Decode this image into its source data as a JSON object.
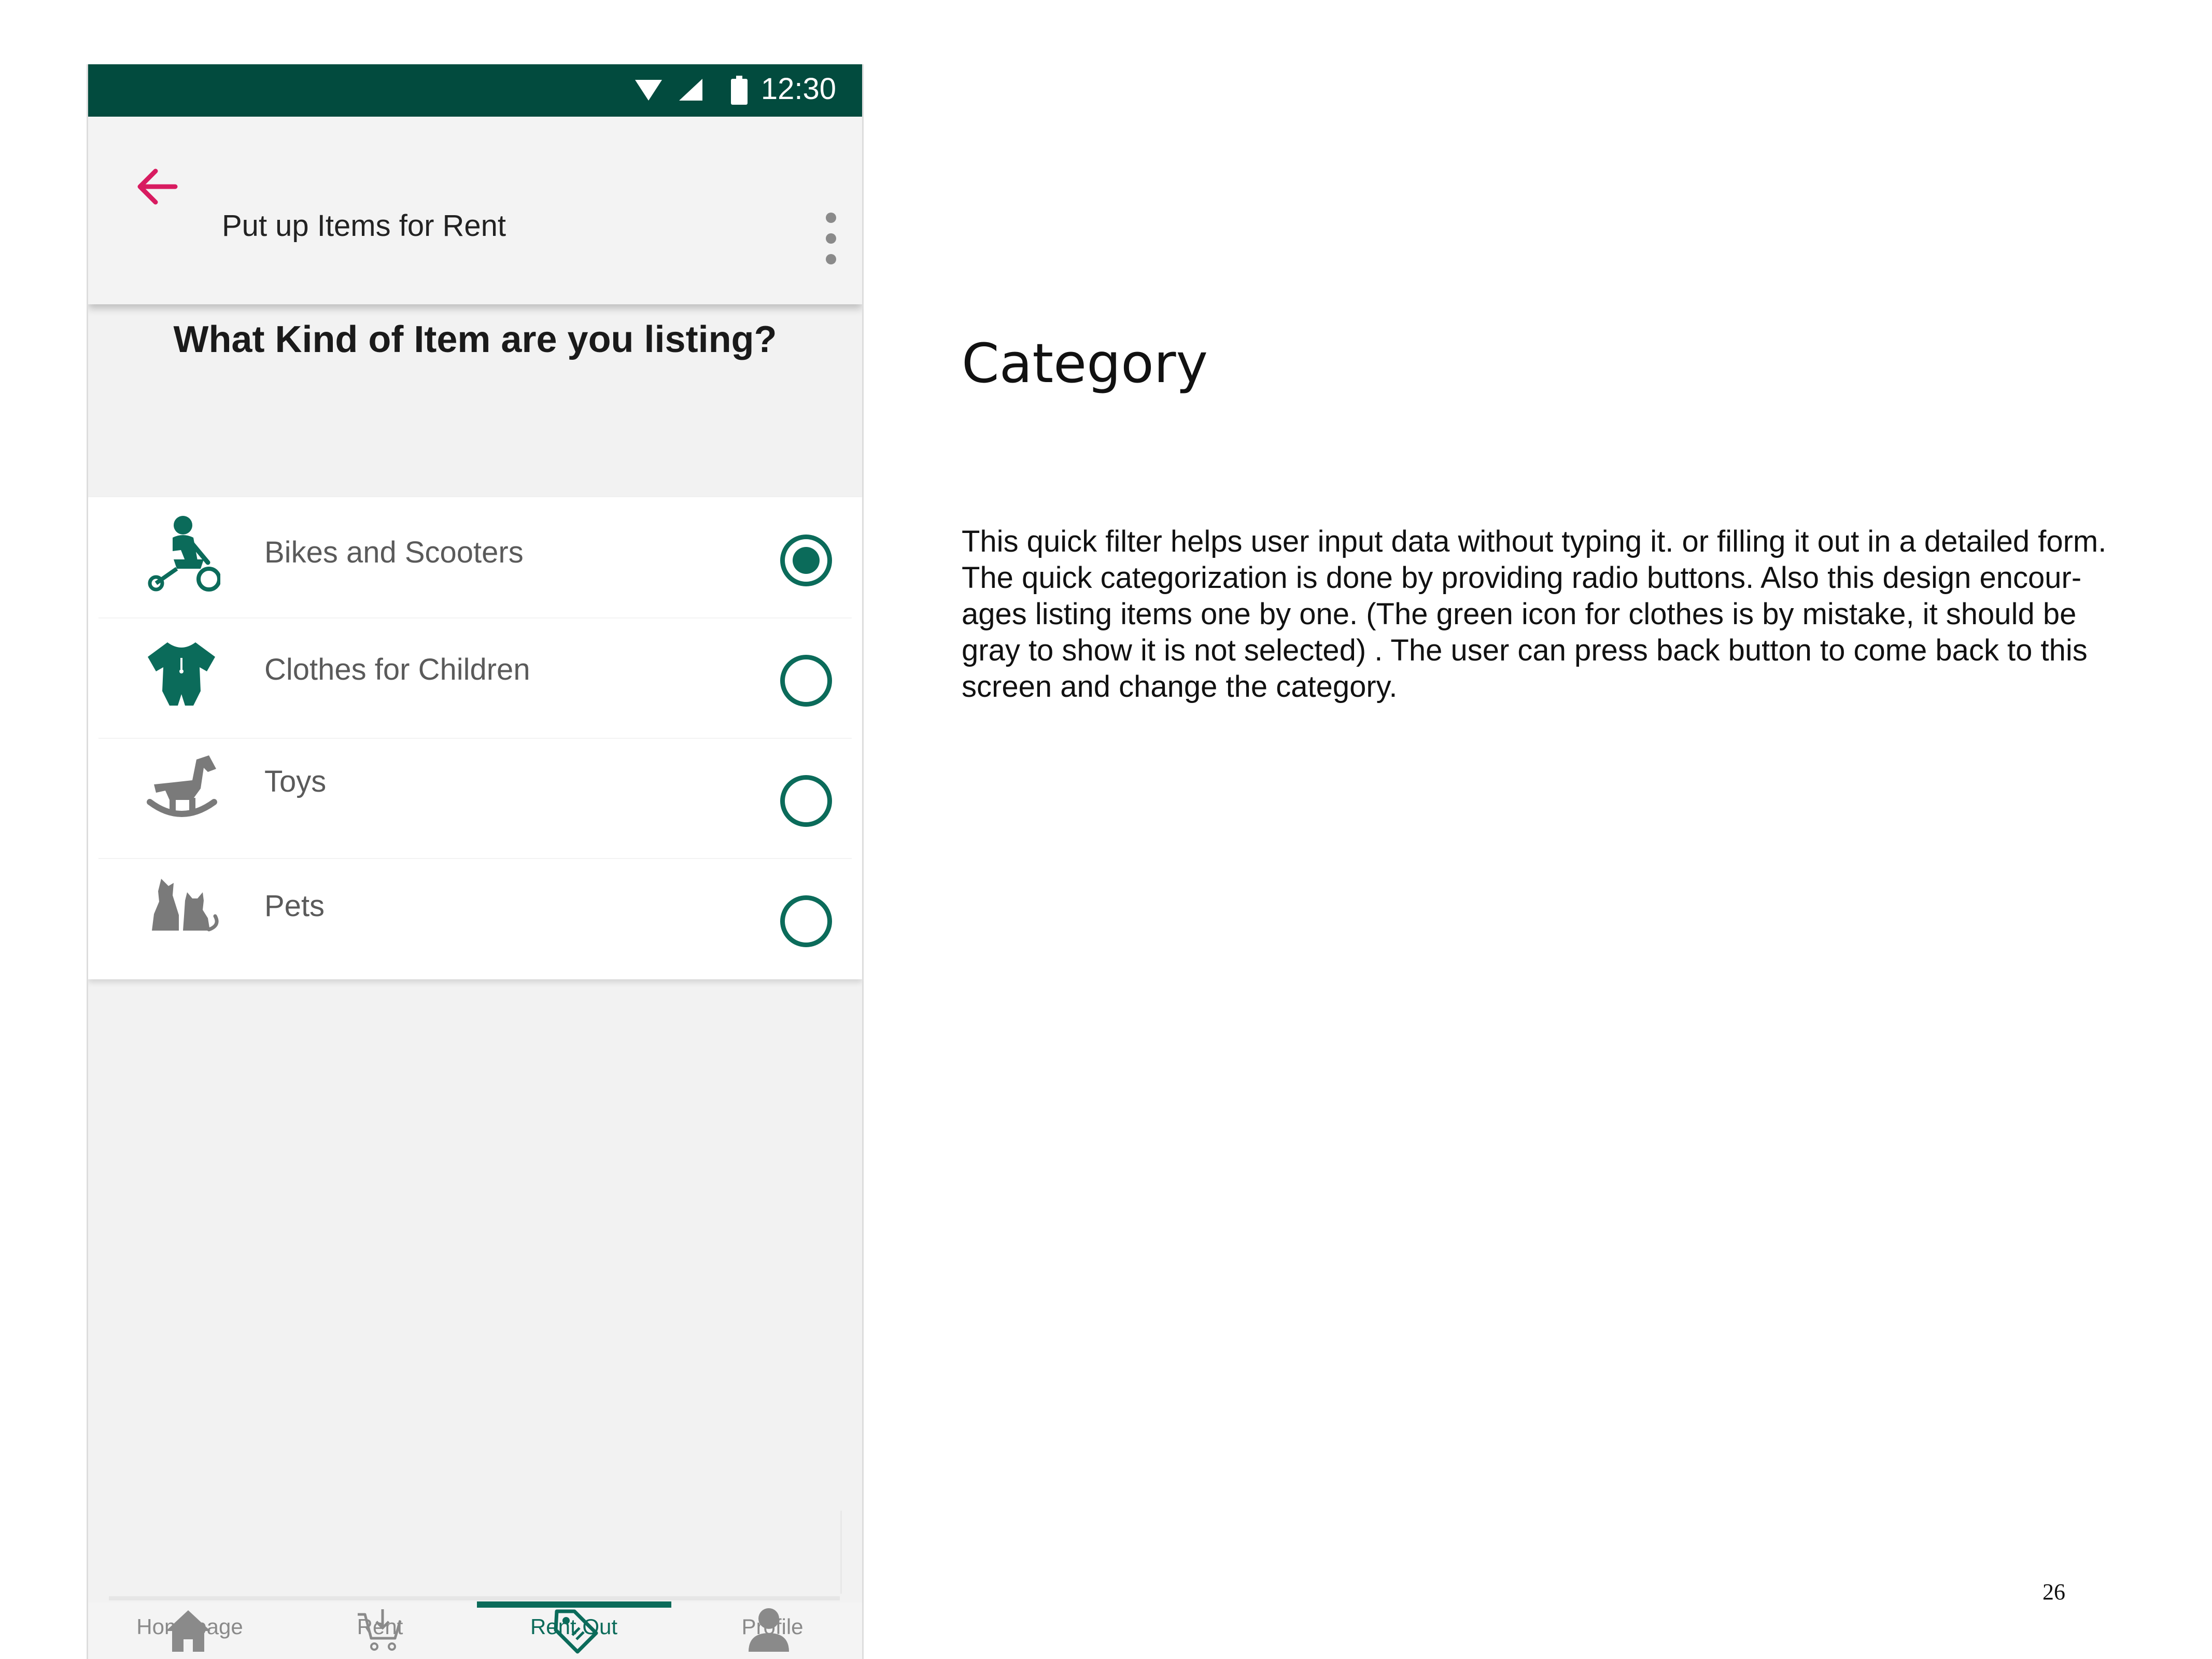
{
  "status_bar": {
    "time": "12:30"
  },
  "app_bar": {
    "title": "Put up Items for Rent"
  },
  "question": "What Kind of Item are you listing?",
  "categories": [
    {
      "label": "Bikes and Scooters",
      "icon": "bike-icon",
      "selected": true,
      "icon_color": "#0b6b5a"
    },
    {
      "label": "Clothes for Children",
      "icon": "baby-clothes-icon",
      "selected": false,
      "icon_color": "#0b6b5a"
    },
    {
      "label": "Toys",
      "icon": "rocking-horse-icon",
      "selected": false,
      "icon_color": "#7a7a7a"
    },
    {
      "label": "Pets",
      "icon": "pets-icon",
      "selected": false,
      "icon_color": "#7a7a7a"
    }
  ],
  "bottom_nav": [
    {
      "label": "Homepage",
      "icon": "home-icon",
      "active": false
    },
    {
      "label": "Rent",
      "icon": "cart-icon",
      "active": false
    },
    {
      "label": "Rent Out",
      "icon": "tag-icon",
      "active": true
    },
    {
      "label": "Profile",
      "icon": "person-icon",
      "active": false
    }
  ],
  "annotation": {
    "heading": "Category",
    "lines": [
      "This quick filter helps user input data without typing it. or filling it out in a detailed form.",
      "The quick categorization is done by providing radio buttons. Also this design encour-",
      "ages listing items one by one. (The green icon for clothes is by mistake, it should be",
      "gray to show it is not selected) . The user can press back button to come back to this",
      "screen and change the category."
    ]
  },
  "page_number": "26",
  "colors": {
    "status_bar": "#024b3e",
    "accent": "#0b6b5a",
    "back_arrow": "#d81b60",
    "inactive": "#8a8a8a"
  }
}
